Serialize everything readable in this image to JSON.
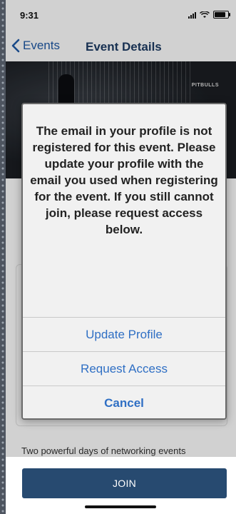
{
  "status_bar": {
    "time": "9:31"
  },
  "nav": {
    "back_label": "Events",
    "title": "Event Details"
  },
  "hero": {
    "badge": "PITBULLS"
  },
  "event": {
    "description": "Two powerful days of networking events"
  },
  "footer": {
    "join_label": "JOIN"
  },
  "alert": {
    "message": "The email in your profile is not registered for this event. Please update your profile with the email you used when registering for the event. If you still cannot join, please request access below.",
    "buttons": [
      "Update Profile",
      "Request Access",
      "Cancel"
    ]
  },
  "colors": {
    "accent": "#274a70",
    "link": "#2f6fc4",
    "nav_title": "#1e3c64"
  }
}
